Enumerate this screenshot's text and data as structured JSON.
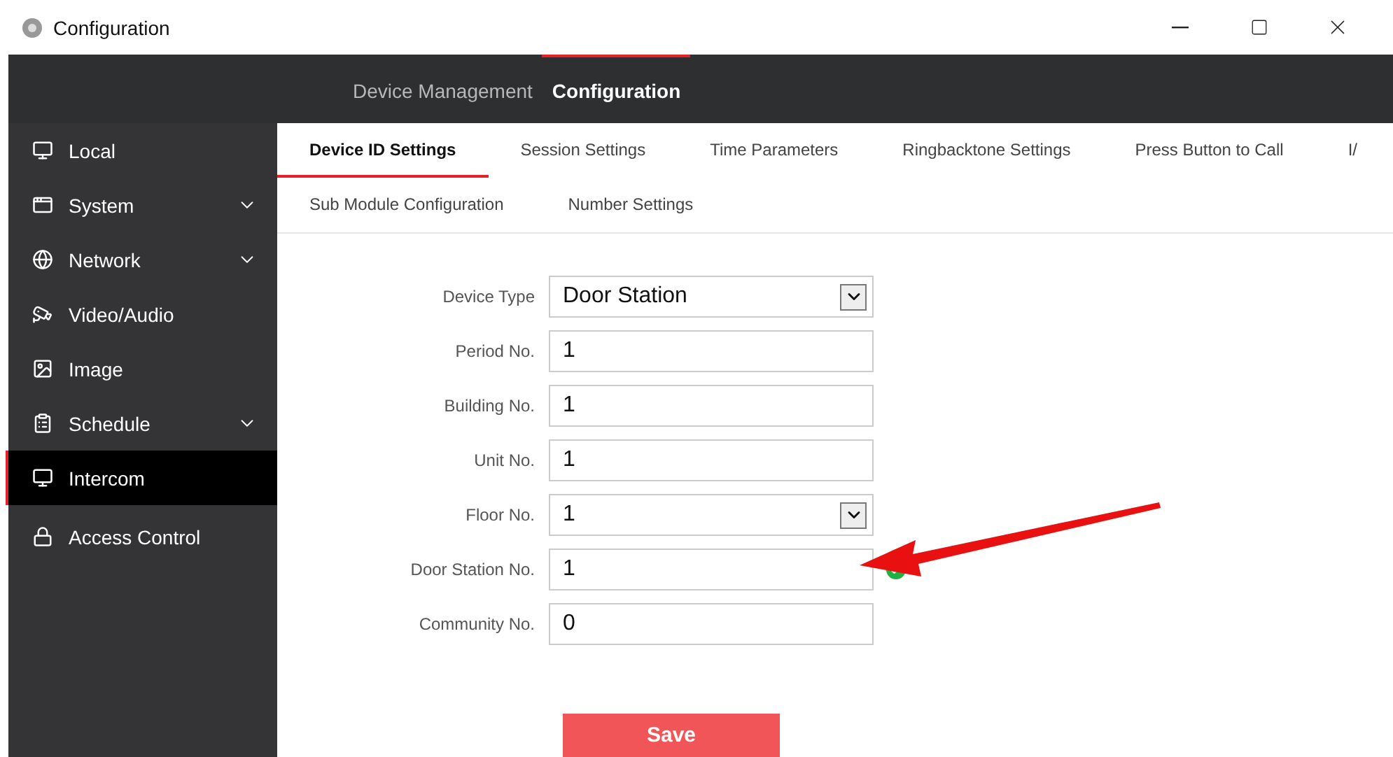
{
  "window": {
    "title": "Configuration"
  },
  "top_nav": [
    {
      "label": "Device Management",
      "selected": false
    },
    {
      "label": "Configuration",
      "selected": true
    }
  ],
  "sidebar": {
    "items": [
      {
        "label": "Local",
        "expandable": false,
        "selected": false
      },
      {
        "label": "System",
        "expandable": true,
        "selected": false
      },
      {
        "label": "Network",
        "expandable": true,
        "selected": false
      },
      {
        "label": "Video/Audio",
        "expandable": false,
        "selected": false
      },
      {
        "label": "Image",
        "expandable": false,
        "selected": false
      },
      {
        "label": "Schedule",
        "expandable": true,
        "selected": false
      },
      {
        "label": "Intercom",
        "expandable": false,
        "selected": true
      },
      {
        "label": "Access Control",
        "expandable": false,
        "selected": false
      }
    ]
  },
  "tab_rows": [
    [
      {
        "label": "Device ID Settings",
        "selected": true
      },
      {
        "label": "Session Settings",
        "selected": false
      },
      {
        "label": "Time Parameters",
        "selected": false
      },
      {
        "label": "Ringbacktone Settings",
        "selected": false
      },
      {
        "label": "Press Button to Call",
        "selected": false
      },
      {
        "label": "I/",
        "selected": false
      }
    ],
    [
      {
        "label": "Sub Module Configuration",
        "selected": false
      },
      {
        "label": "Number Settings",
        "selected": false
      }
    ]
  ],
  "form": {
    "fields": [
      {
        "label": "Device Type",
        "kind": "select",
        "value": "Door Station",
        "valid": false
      },
      {
        "label": "Period No.",
        "kind": "input",
        "value": "1",
        "valid": false
      },
      {
        "label": "Building No.",
        "kind": "input",
        "value": "1",
        "valid": false
      },
      {
        "label": "Unit No.",
        "kind": "input",
        "value": "1",
        "valid": false
      },
      {
        "label": "Floor No.",
        "kind": "select",
        "value": "1",
        "valid": false
      },
      {
        "label": "Door Station No.",
        "kind": "input",
        "value": "1",
        "valid": true
      },
      {
        "label": "Community No.",
        "kind": "input",
        "value": "0",
        "valid": false
      }
    ],
    "save_button": "Save"
  }
}
